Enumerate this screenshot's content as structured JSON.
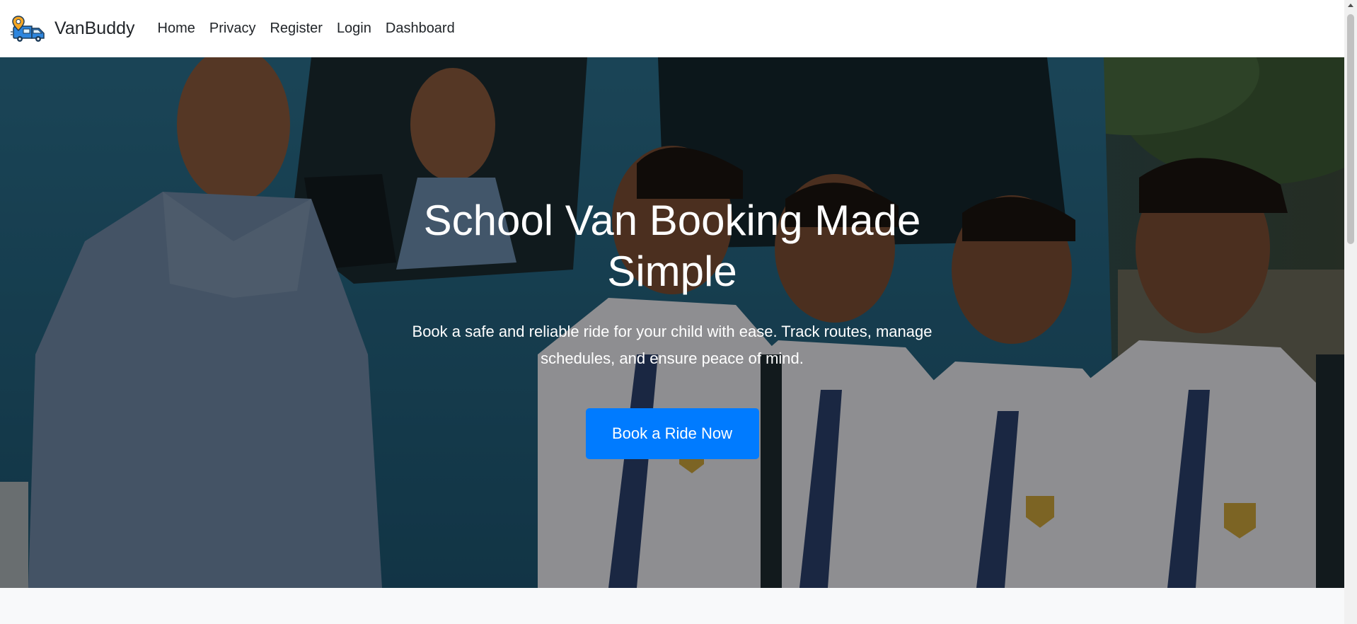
{
  "navbar": {
    "brand_name": "VanBuddy",
    "links": [
      {
        "label": "Home"
      },
      {
        "label": "Privacy"
      },
      {
        "label": "Register"
      },
      {
        "label": "Login"
      },
      {
        "label": "Dashboard"
      }
    ],
    "logo_icon": "van-location-pin-icon"
  },
  "hero": {
    "title": "School Van Booking Made Simple",
    "subtitle": "Book a safe and reliable ride for your child with ease. Track routes, manage schedules, and ensure peace of mind.",
    "cta_label": "Book a Ride Now",
    "background_image": "smiling-driver-and-schoolchildren-by-blue-van-photo"
  },
  "colors": {
    "accent": "#007bff",
    "nav_background": "#ffffff",
    "nav_text": "#212529",
    "hero_text": "#ffffff",
    "page_background": "#f8f9fa",
    "logo_van": "#2e86de",
    "logo_pin": "#f5a623"
  }
}
